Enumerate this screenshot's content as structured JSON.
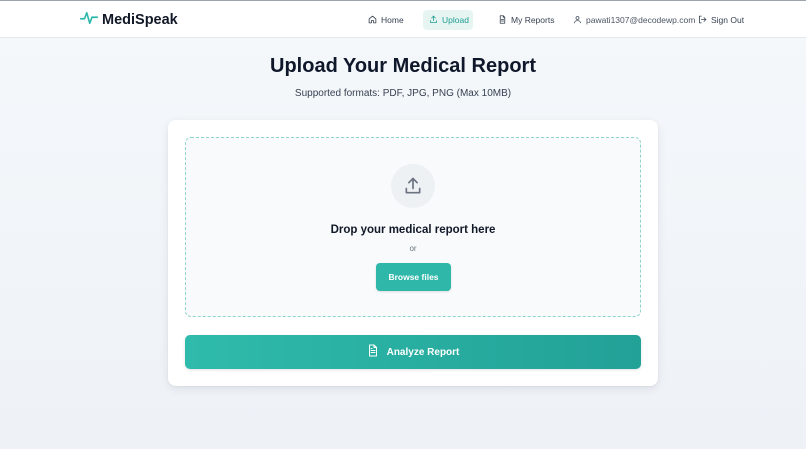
{
  "app": {
    "name": "MediSpeak"
  },
  "nav": {
    "home": "Home",
    "upload": "Upload",
    "reports": "My Reports",
    "user_email": "pawati1307@decodewp.com",
    "sign_out": "Sign Out"
  },
  "main": {
    "title": "Upload Your Medical Report",
    "subtitle": "Supported formats: PDF, JPG, PNG (Max 10MB)"
  },
  "dropzone": {
    "title": "Drop your medical report here",
    "or": "or",
    "browse_label": "Browse files"
  },
  "analyze": {
    "label": "Analyze Report"
  },
  "colors": {
    "brand": "#2fb8aa",
    "brand_dark": "#22a197",
    "active_nav_bg": "#e6f4f2",
    "active_nav_text": "#1f9e92"
  },
  "icons": {
    "brand": "pulse-icon",
    "home": "home-icon",
    "upload": "upload-icon",
    "reports": "document-icon",
    "user": "user-icon",
    "sign_out": "sign-out-icon",
    "dropzone": "upload-arrow-icon",
    "analyze": "file-text-icon"
  }
}
